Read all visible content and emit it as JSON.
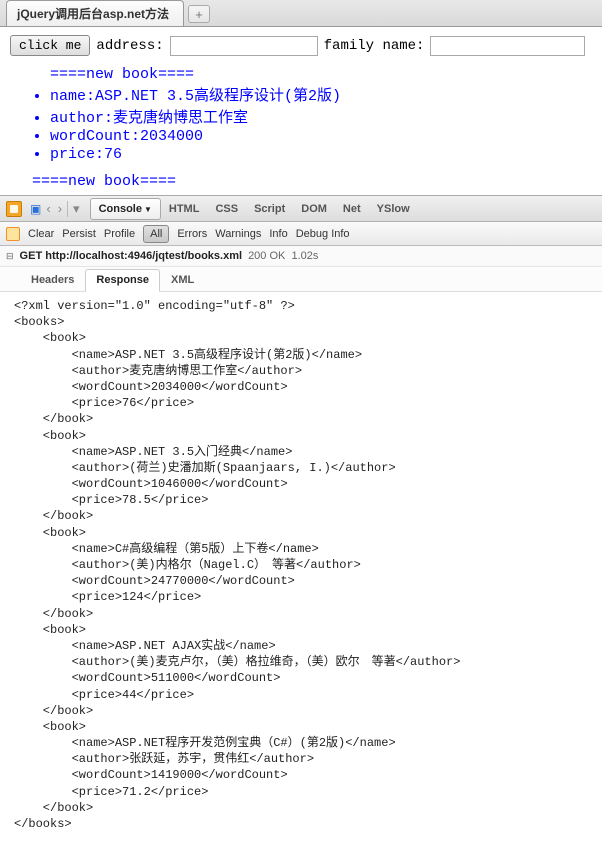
{
  "tab_title": "jQuery调用后台asp.net方法",
  "page": {
    "button_label": "click me",
    "address_label": "address:",
    "family_label": "family name:",
    "address_value": "",
    "family_value": "",
    "sep": "====new book====",
    "items": [
      "name:ASP.NET 3.5高级程序设计(第2版)",
      "author:麦克唐纳博思工作室",
      "wordCount:2034000",
      "price:76"
    ]
  },
  "dev": {
    "tabs": [
      "Console",
      "HTML",
      "CSS",
      "Script",
      "DOM",
      "Net",
      "YSlow"
    ],
    "active_tab": 0,
    "row2": [
      "Clear",
      "Persist",
      "Profile",
      "All",
      "Errors",
      "Warnings",
      "Info",
      "Debug Info"
    ],
    "row2_active": 3,
    "req": {
      "method": "GET",
      "url": "http://localhost:4946/jqtest/books.xml",
      "status": "200 OK",
      "time": "1.02s"
    },
    "sub_tabs": [
      "Headers",
      "Response",
      "XML"
    ],
    "sub_active": 1
  },
  "chart_data": {
    "type": "table",
    "title": "books.xml",
    "series": [
      {
        "name": "ASP.NET 3.5高级程序设计(第2版)",
        "author": "麦克唐纳博思工作室",
        "wordCount": 2034000,
        "price": 76
      },
      {
        "name": "ASP.NET 3.5入门经典",
        "author": "(荷兰)史潘加斯(Spaanjaars, I.)",
        "wordCount": 1046000,
        "price": 78.5
      },
      {
        "name": "C#高级编程（第5版）上下卷",
        "author": "(美)内格尔（Nagel.C）　等著",
        "wordCount": 24770000,
        "price": 124
      },
      {
        "name": "ASP.NET AJAX实战",
        "author": "(美)麦克卢尔，（美）格拉维奇，（美）欧尔　等著",
        "wordCount": 511000,
        "price": 44
      },
      {
        "name": "ASP.NET程序开发范例宝典（C#）(第2版)",
        "author": "张跃延，苏宇，贯伟红",
        "wordCount": 1419000,
        "price": 71.2
      }
    ]
  }
}
